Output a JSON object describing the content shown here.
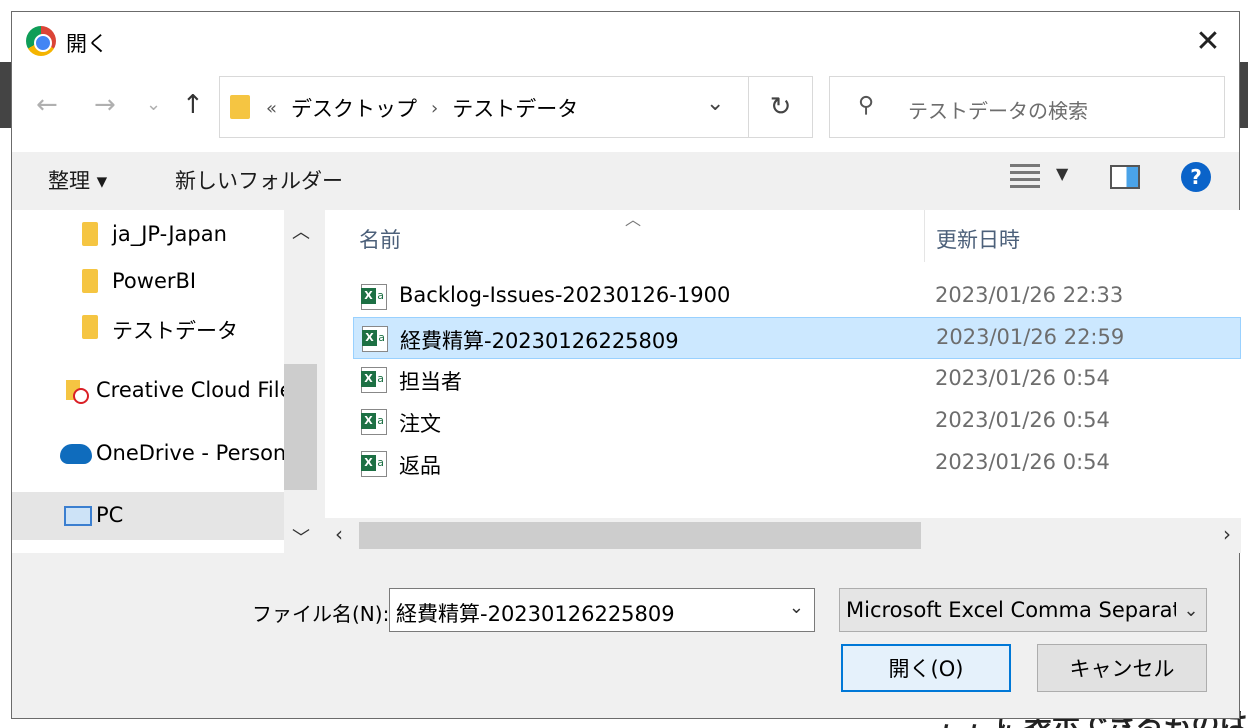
{
  "dialog": {
    "title": "開く",
    "close_glyph": "✕"
  },
  "nav": {
    "back_glyph": "←",
    "forward_glyph": "→",
    "recent_glyph": "⌄",
    "up_glyph": "↑"
  },
  "address": {
    "overflow": "«",
    "crumbs": [
      "デスクトップ",
      "テストデータ"
    ],
    "separator": "›",
    "dropdown_glyph": "⌄",
    "refresh_glyph": "↻"
  },
  "search": {
    "icon": "⚲",
    "placeholder": "テストデータの検索"
  },
  "toolbar": {
    "organize_label": "整理 ▾",
    "new_folder_label": "新しいフォルダー",
    "view_dropdown_glyph": "▼",
    "help_glyph": "?"
  },
  "tree": {
    "items": [
      {
        "label": "ja_JP-Japan",
        "icon": "folder-icon"
      },
      {
        "label": "PowerBI",
        "icon": "folder-icon"
      },
      {
        "label": "テストデータ",
        "icon": "folder-icon"
      },
      {
        "label": "Creative Cloud Files",
        "icon": "creative-cloud-icon"
      },
      {
        "label": "OneDrive - Personal",
        "icon": "onedrive-icon"
      },
      {
        "label": "PC",
        "icon": "pc-icon"
      }
    ],
    "up_glyph": "︿",
    "down_glyph": "﹀"
  },
  "files": {
    "headers": {
      "name": "名前",
      "date": "更新日時"
    },
    "sort_glyph": "︿",
    "rows": [
      {
        "name": "Backlog-Issues-20230126-1900",
        "date": "2023/01/26 22:33"
      },
      {
        "name": "経費精算-20230126225809",
        "date": "2023/01/26 22:59"
      },
      {
        "name": "担当者",
        "date": "2023/01/26 0:54"
      },
      {
        "name": "注文",
        "date": "2023/01/26 0:54"
      },
      {
        "name": "返品",
        "date": "2023/01/26 0:54"
      }
    ],
    "selected_index": 1,
    "scroll_left_glyph": "‹",
    "scroll_right_glyph": "›"
  },
  "bottom": {
    "filename_label": "ファイル名(N):",
    "filename_value": "経費精算-20230126225809",
    "filename_dd_glyph": "⌄",
    "filetype_value": "Microsoft Excel Comma Separated",
    "filetype_dd_glyph": "⌄",
    "open_label": "開く(O)",
    "cancel_label": "キャンセル"
  },
  "background": {
    "bottom_text": "ここに表示できるものは何"
  }
}
